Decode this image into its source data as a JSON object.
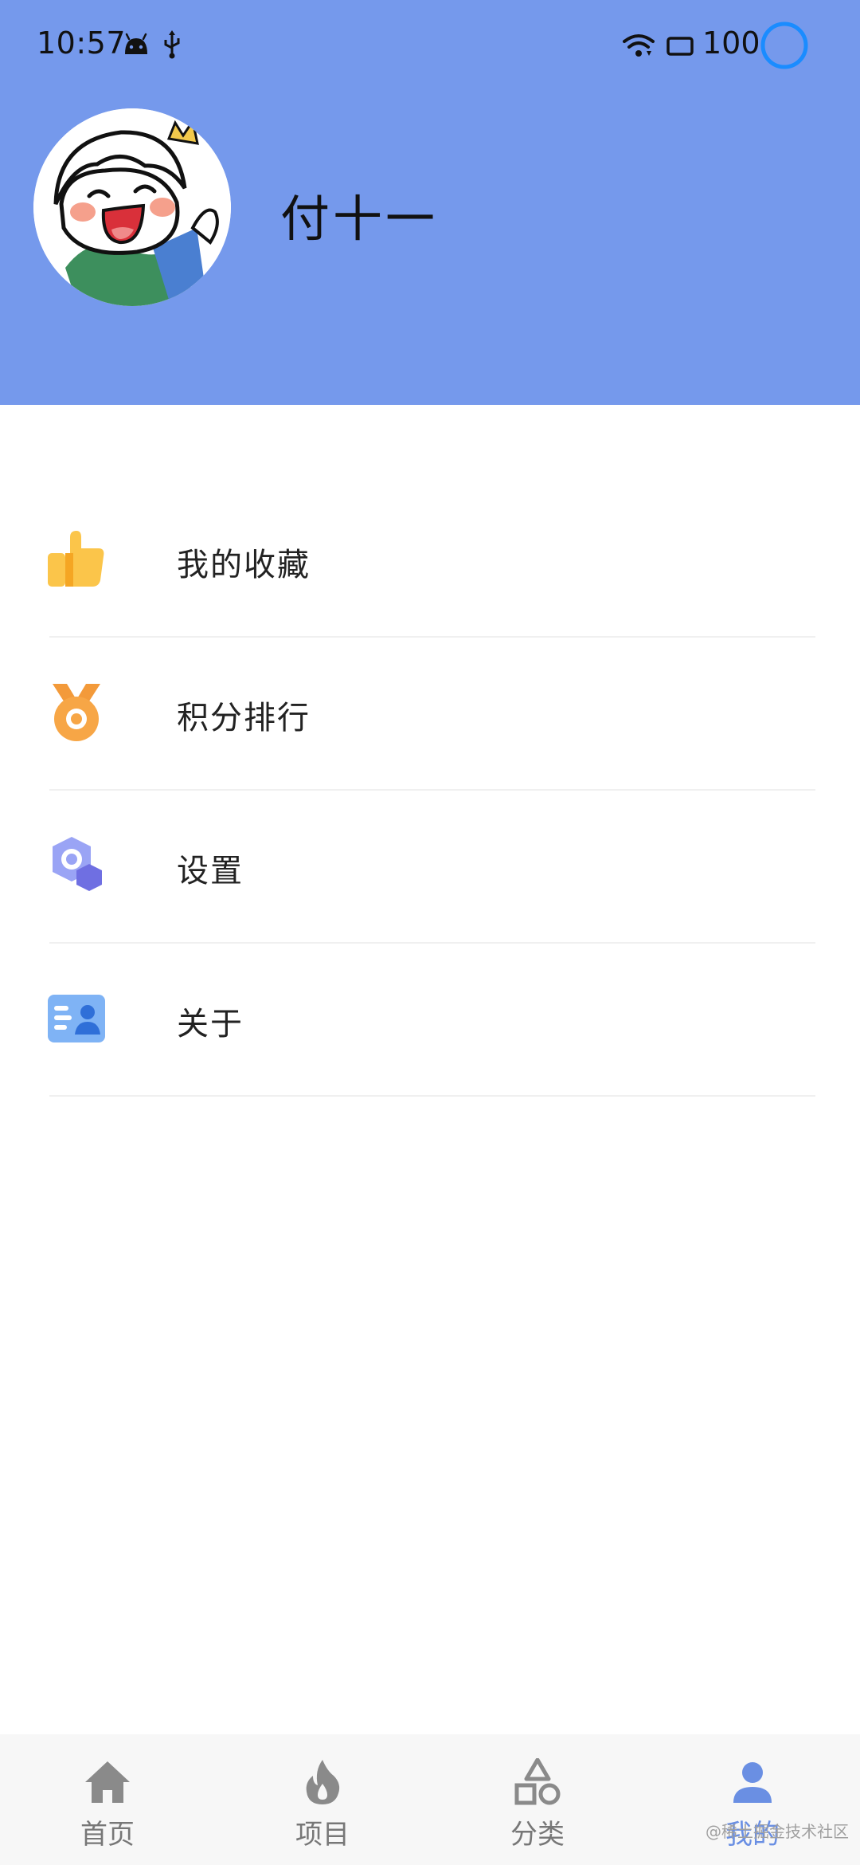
{
  "status_bar": {
    "time": "10:57",
    "battery": "100"
  },
  "profile": {
    "username": "付十一",
    "avatar": "cartoon-avatar"
  },
  "menu": [
    {
      "label": "我的收藏",
      "icon": "thumbs-up-icon"
    },
    {
      "label": "积分排行",
      "icon": "medal-icon"
    },
    {
      "label": "设置",
      "icon": "settings-icon"
    },
    {
      "label": "关于",
      "icon": "id-card-icon"
    }
  ],
  "bottom_nav": [
    {
      "label": "首页",
      "icon": "home-icon",
      "active": false
    },
    {
      "label": "项目",
      "icon": "flame-icon",
      "active": false
    },
    {
      "label": "分类",
      "icon": "shapes-icon",
      "active": false
    },
    {
      "label": "我的",
      "icon": "person-icon",
      "active": true
    }
  ],
  "watermark": "@稀土掘金技术社区",
  "colors": {
    "header_bg": "#7599ec",
    "accent": "#6a8fe3"
  }
}
